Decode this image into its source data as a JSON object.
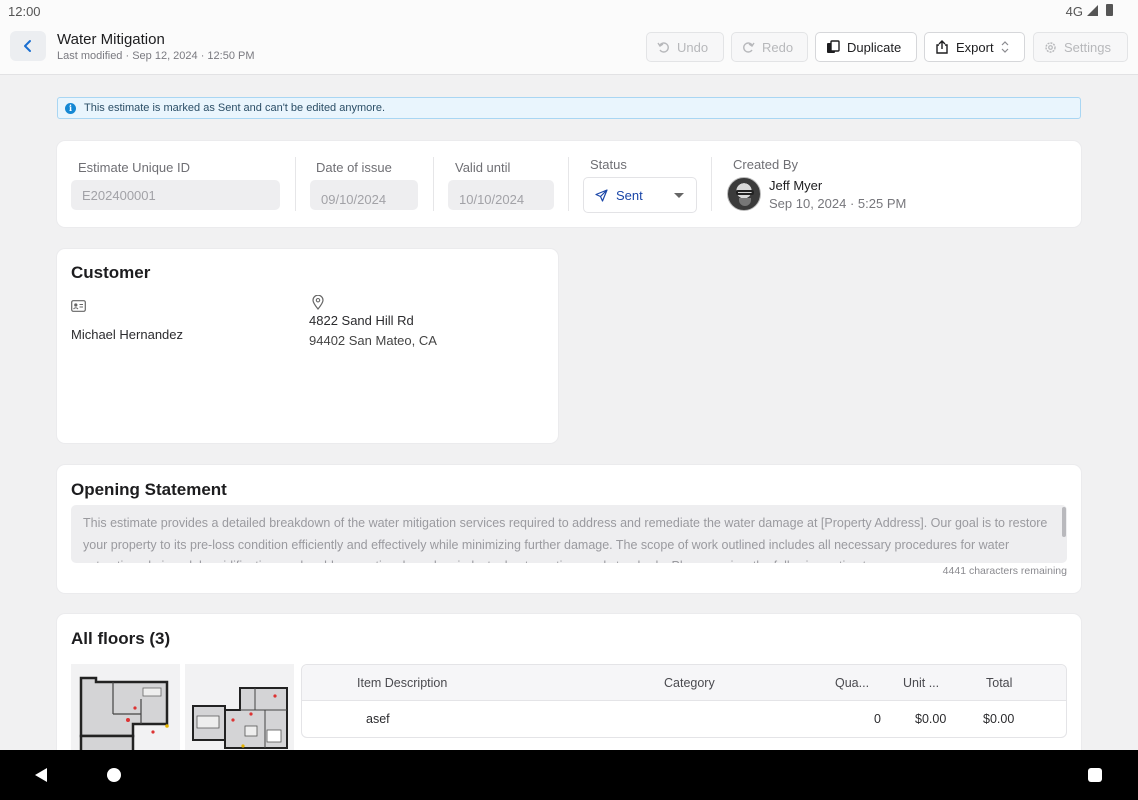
{
  "statusbar": {
    "time": "12:00",
    "network": "4G"
  },
  "header": {
    "title": "Water Mitigation",
    "subtitle": "Last modified · Sep 12, 2024 · 12:50 PM",
    "buttons": {
      "undo": "Undo",
      "redo": "Redo",
      "duplicate": "Duplicate",
      "export": "Export",
      "settings": "Settings"
    }
  },
  "banner": {
    "text": "This estimate is marked as Sent and can't be edited anymore."
  },
  "meta": {
    "id_label": "Estimate Unique ID",
    "id_value": "E202400001",
    "issue_label": "Date of issue",
    "issue_value": "09/10/2024",
    "valid_label": "Valid until",
    "valid_value": "10/10/2024",
    "status_label": "Status",
    "status_value": "Sent",
    "created_label": "Created By",
    "created_name": "Jeff Myer",
    "created_date": "Sep 10, 2024 · 5:25 PM"
  },
  "customer": {
    "title": "Customer",
    "name": "Michael Hernandez",
    "address_line1": "4822 Sand Hill Rd",
    "address_line2": "94402 San Mateo, CA"
  },
  "opening": {
    "title": "Opening Statement",
    "text": "This estimate provides a detailed breakdown of the water mitigation services required to address and remediate the water damage at [Property Address]. Our goal is to restore your property to its pre-loss condition efficiently and effectively while minimizing further damage. The scope of work outlined includes all necessary procedures for water extraction, drying, dehumidification, and mold prevention, based on industry best practices and standards. Please review the following estimate",
    "chars_remaining": "4441 characters remaining"
  },
  "floors": {
    "title": "All floors (3)",
    "columns": [
      "Item Description",
      "Category",
      "Qua...",
      "Unit ...",
      "Total"
    ],
    "rows": [
      {
        "description": "asef",
        "category": "",
        "quantity": "0",
        "unit": "$0.00",
        "total": "$0.00"
      }
    ]
  }
}
